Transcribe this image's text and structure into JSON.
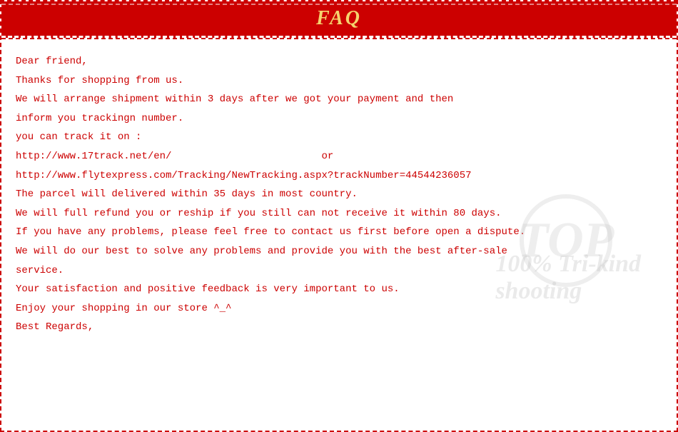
{
  "header": {
    "title": "FAQ",
    "background_color": "#cc0000",
    "title_color": "#f5d26e"
  },
  "content": {
    "lines": [
      "Dear friend,",
      "Thanks for shopping from us.",
      "We will arrange shipment within 3 days after we got your payment and then",
      "inform you trackingn number.",
      "you can track it on :",
      "http://www.17track.net/en/                         or",
      "http://www.flytexpress.com/Tracking/NewTracking.aspx?trackNumber=44544236057",
      "The parcel will delivered within 35 days in most country.",
      "We will full refund you or reship if you still can not receive it within 80 days.",
      "If you have any problems, please feel free to contact us first before open a dispute.",
      "We will do our best to solve any problems and provide you with the best after-sale",
      "service.",
      "Your satisfaction and positive feedback is very important to us.",
      "Enjoy your shopping in our store ^_^",
      "Best Regards,"
    ]
  },
  "watermark": {
    "circle_text": "TOP",
    "line1": "100% Tri-kind",
    "line2": "shooting"
  }
}
